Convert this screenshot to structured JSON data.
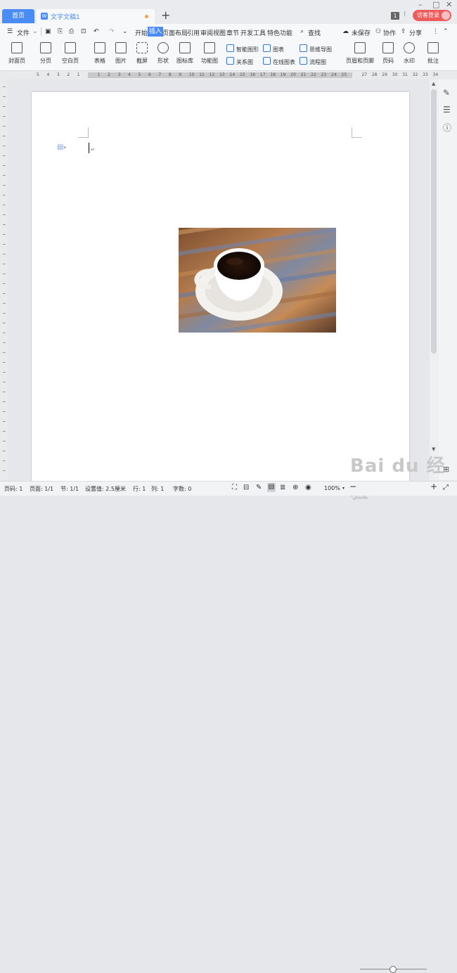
{
  "tabs": {
    "home": "首页",
    "doc": "文字文稿1",
    "login": "访客登录",
    "count": "1"
  },
  "menu": {
    "file": "文件",
    "items": [
      "开始",
      "插入",
      "页面布局",
      "引用",
      "审阅",
      "视图",
      "章节",
      "开发工具",
      "特色功能"
    ],
    "active": "插入",
    "search": "查找",
    "unsaved": "未保存",
    "collab": "协作",
    "share": "分享"
  },
  "ribbon": {
    "big": [
      "封面页",
      "分页",
      "空白页",
      "表格",
      "图片",
      "截屏",
      "形状",
      "图标库",
      "功能图"
    ],
    "small_left": [
      "智能图形",
      "关系图"
    ],
    "small_mid": [
      "图表",
      "在线图表"
    ],
    "small_right": [
      "思维导图",
      "流程图"
    ],
    "big_right": [
      "页眉和页脚",
      "页码",
      "水印",
      "批注"
    ]
  },
  "ruler": {
    "ticks": [
      "5",
      "4",
      "3",
      "2",
      "1",
      "",
      "1",
      "2",
      "3",
      "4",
      "5",
      "6",
      "7",
      "8",
      "9",
      "10",
      "11",
      "12",
      "13",
      "14",
      "15",
      "16",
      "17",
      "18",
      "19",
      "20",
      "21",
      "22",
      "23",
      "24",
      "25",
      "",
      "27",
      "28",
      "29",
      "30",
      "31",
      "32",
      "33",
      "34"
    ]
  },
  "status": {
    "page": "页码: 1",
    "pages": "页面: 1/1",
    "section": "节: 1/1",
    "setting": "设置值: 2.5厘米",
    "row": "行: 1",
    "col": "列: 1",
    "words": "字数: 0",
    "zoom": "100%"
  },
  "watermark": "Bai du 经验"
}
